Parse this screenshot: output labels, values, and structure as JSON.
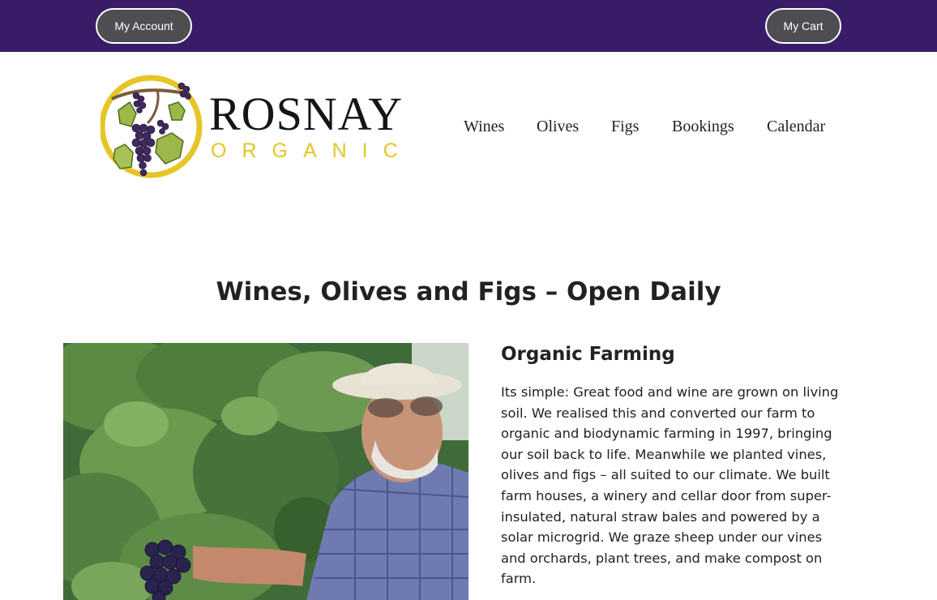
{
  "topbar": {
    "account_label": "My Account",
    "cart_label": "My Cart",
    "background": "#381c68"
  },
  "logo": {
    "title": "ROSNAY",
    "subtitle": "ORGANIC",
    "accent": "#e6c527"
  },
  "nav": {
    "items": [
      {
        "label": "Wines"
      },
      {
        "label": "Olives"
      },
      {
        "label": "Figs"
      },
      {
        "label": "Bookings"
      },
      {
        "label": "Calendar"
      }
    ]
  },
  "main": {
    "headline": "Wines, Olives and Figs – Open Daily",
    "section_title": "Organic Farming",
    "section_body": "Its simple: Great food and wine are grown on living soil. We realised this and converted our farm to organic and biodynamic farming in 1997, bringing our soil back to life. Meanwhile we planted vines, olives and figs – all suited to our climate. We built farm houses, a winery and cellar door from super-insulated, natural straw bales and powered by a solar microgrid. We graze sheep under our vines and orchards, plant trees, and make compost on farm."
  }
}
